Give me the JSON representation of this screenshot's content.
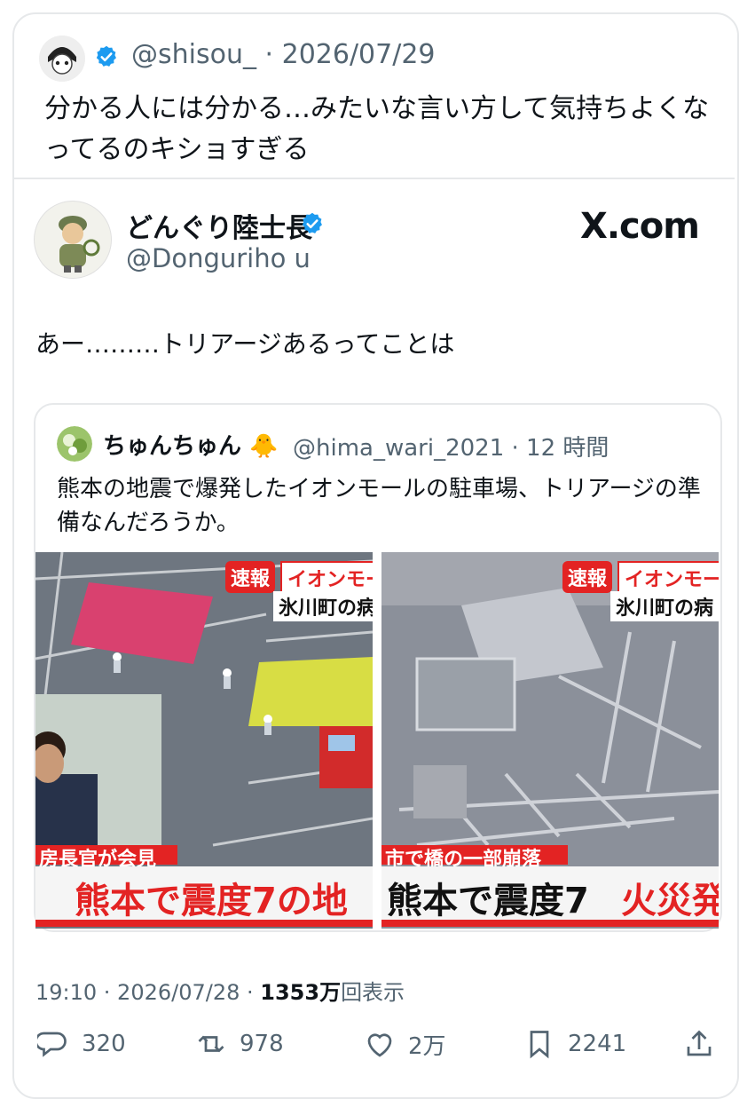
{
  "top_tweet": {
    "handle": "@shisou_",
    "date": "· 2026/07/29",
    "text": "分かる人には分かる…みたいな言い方して気持ちよくなってるのキショすぎる"
  },
  "embedded_tweet": {
    "display_name": "どんぐり陸士長",
    "handle": "@Donguriho u",
    "source": "X.com",
    "text": "あー………トリアージあるってことは"
  },
  "quoted_tweet": {
    "display_name": "ちゅんちゅん",
    "handle": "@hima_wari_2021 · 12 時間",
    "text": "熊本の地震で爆発したイオンモールの駐車場、トリアージの準備なんだろうか。"
  },
  "photo_left": {
    "breaking": "速報",
    "tag1": "イオンモー",
    "tag2": "氷川町の病",
    "sub": "房長官が会見",
    "headline": "熊本で震度7の地"
  },
  "photo_right": {
    "breaking": "速報",
    "tag1": "イオンモー",
    "tag2": "氷川町の病",
    "sub": "市で橋の一部崩落",
    "headline_a": "熊本で震度7",
    "headline_b": "火災発"
  },
  "meta": {
    "time": "19:10 · 2026/07/28 · ",
    "views_number": "1353",
    "views_unit": "万",
    "views_label": "回表示"
  },
  "actions": {
    "replies": "320",
    "reposts": "978",
    "likes": "2万",
    "bookmarks": "2241"
  },
  "colors": {
    "verified": "#1d9bf0",
    "text_secondary": "#536471",
    "news_red": "#e32323"
  }
}
